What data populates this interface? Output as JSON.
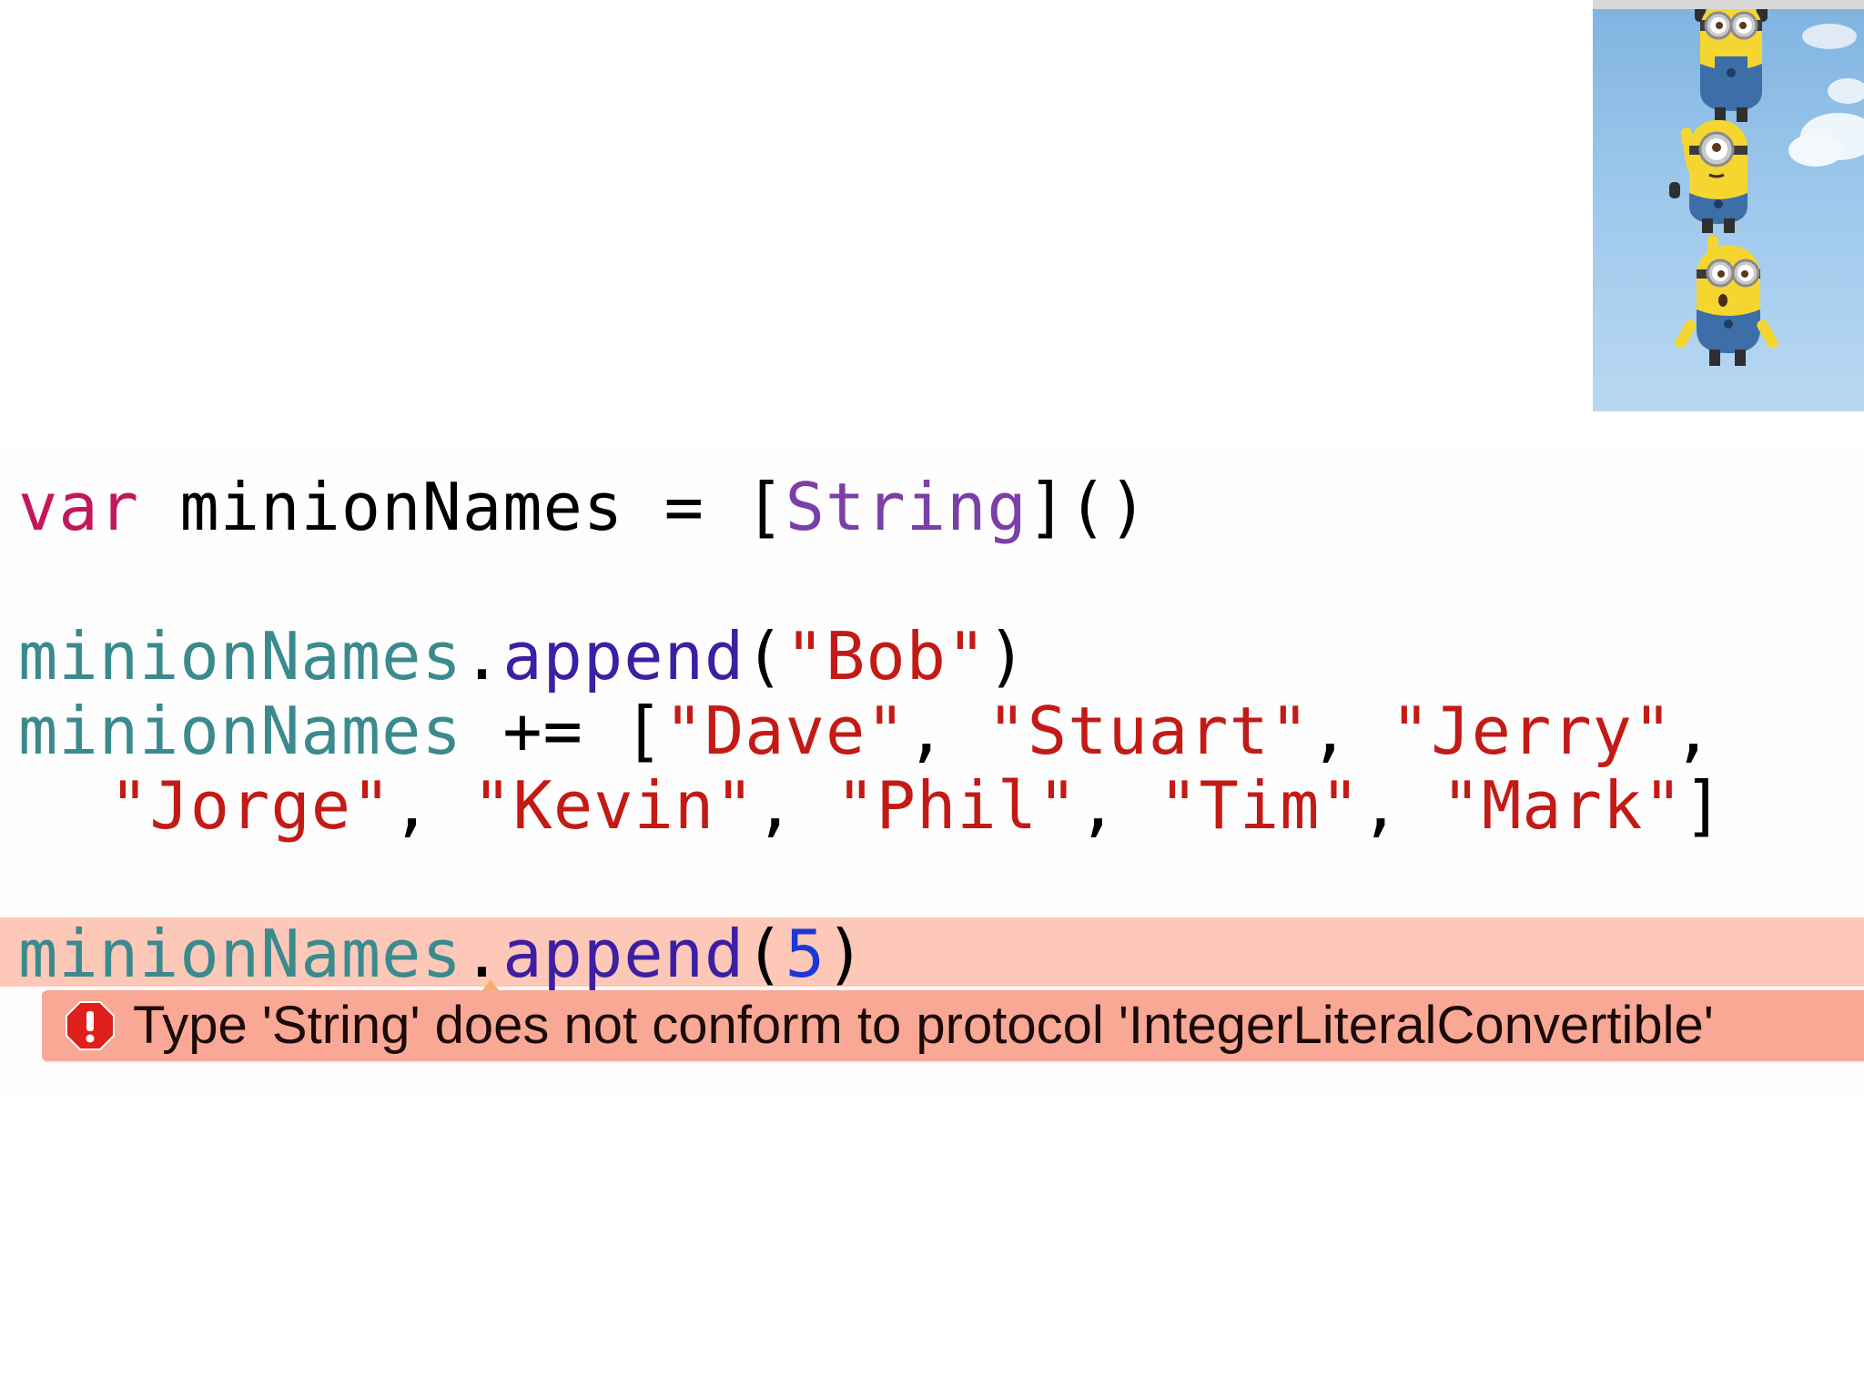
{
  "code": {
    "line1": {
      "keyword": "var",
      "name": "minionNames",
      "equals": "=",
      "open_bracket": "[",
      "type": "String",
      "close": "]()"
    },
    "line2": {
      "receiver": "minionNames",
      "dot": ".",
      "method": "append",
      "open": "(",
      "arg": "\"Bob\"",
      "close": ")"
    },
    "line3": {
      "receiver": "minionNames",
      "operator": "+=",
      "open": "[",
      "items": [
        "\"Dave\"",
        "\"Stuart\"",
        "\"Jerry\""
      ],
      "comma": ","
    },
    "line4": {
      "items": [
        "\"Jorge\"",
        "\"Kevin\"",
        "\"Phil\"",
        "\"Tim\"",
        "\"Mark\""
      ],
      "comma": ",",
      "close": "]"
    },
    "line5": {
      "receiver": "minionNames",
      "dot": ".",
      "method": "append",
      "open": "(",
      "arg": "5",
      "close": ")"
    }
  },
  "error": {
    "icon": "error-stop-icon",
    "message": "Type 'String' does not conform to protocol 'IntegerLiteralConvertible'"
  },
  "colors": {
    "keyword": "#c2185b",
    "type": "#7b3fa8",
    "variable": "#3a8a8e",
    "method": "#3d1fa3",
    "string": "#c41a16",
    "number": "#1b38d6",
    "error_line": "#fdc8b8",
    "error_bubble": "#f9a896",
    "error_icon": "#e0201a"
  },
  "image": {
    "description_icon": "three-minions-hanging-illustration"
  }
}
